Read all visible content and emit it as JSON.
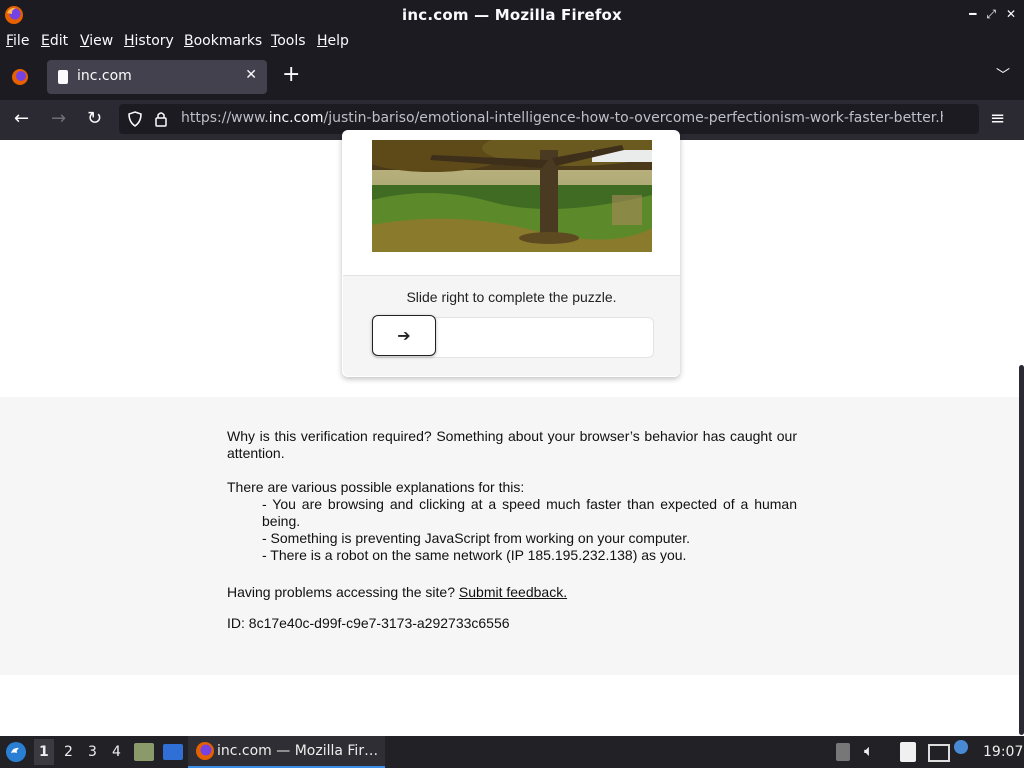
{
  "window": {
    "title": "inc.com — Mozilla Firefox"
  },
  "menubar": {
    "items": [
      {
        "label": "File",
        "u": "F",
        "rest": "ile"
      },
      {
        "label": "Edit",
        "u": "E",
        "rest": "dit"
      },
      {
        "label": "View",
        "u": "V",
        "rest": "iew"
      },
      {
        "label": "History",
        "u": "H",
        "rest": "istory"
      },
      {
        "label": "Bookmarks",
        "u": "B",
        "rest": "ookmarks"
      },
      {
        "label": "Tools",
        "u": "T",
        "rest": "ools"
      },
      {
        "label": "Help",
        "u": "H",
        "rest": "elp"
      }
    ]
  },
  "tab": {
    "label": "inc.com",
    "close": "✕",
    "new_tab": "+"
  },
  "urlbar": {
    "prefix": "https://www.",
    "domain": "inc.com",
    "path": "/justin-bariso/emotional-intelligence-how-to-overcome-perfectionism-work-faster-better.h"
  },
  "captcha": {
    "instruction": "Slide right to complete the puzzle.",
    "handle_glyph": "➔"
  },
  "info": {
    "why": "Why is this verification required? Something about your browser’s behavior has caught our attention.",
    "explanations_heading": "There are various possible explanations for this:",
    "reasons": [
      "- You are browsing and clicking at a speed much faster than expected of a human being.",
      "- Something is preventing JavaScript from working on your computer.",
      "- There is a robot on the same network (IP 185.195.232.138) as you."
    ],
    "problems": "Having problems accessing the site?",
    "feedback_link": "Submit feedback.",
    "id": "ID: 8c17e40c-d99f-c9e7-3173-a292733c6556"
  },
  "taskbar": {
    "workspaces": [
      "1",
      "2",
      "3",
      "4"
    ],
    "active_window": "inc.com — Mozilla Fir…",
    "clock": "19:07"
  },
  "colors": {
    "chrome_dark": "#1c1b22",
    "toolbar": "#2b2a33",
    "tab_active": "#42414d",
    "info_bg": "#f6f6f6"
  }
}
